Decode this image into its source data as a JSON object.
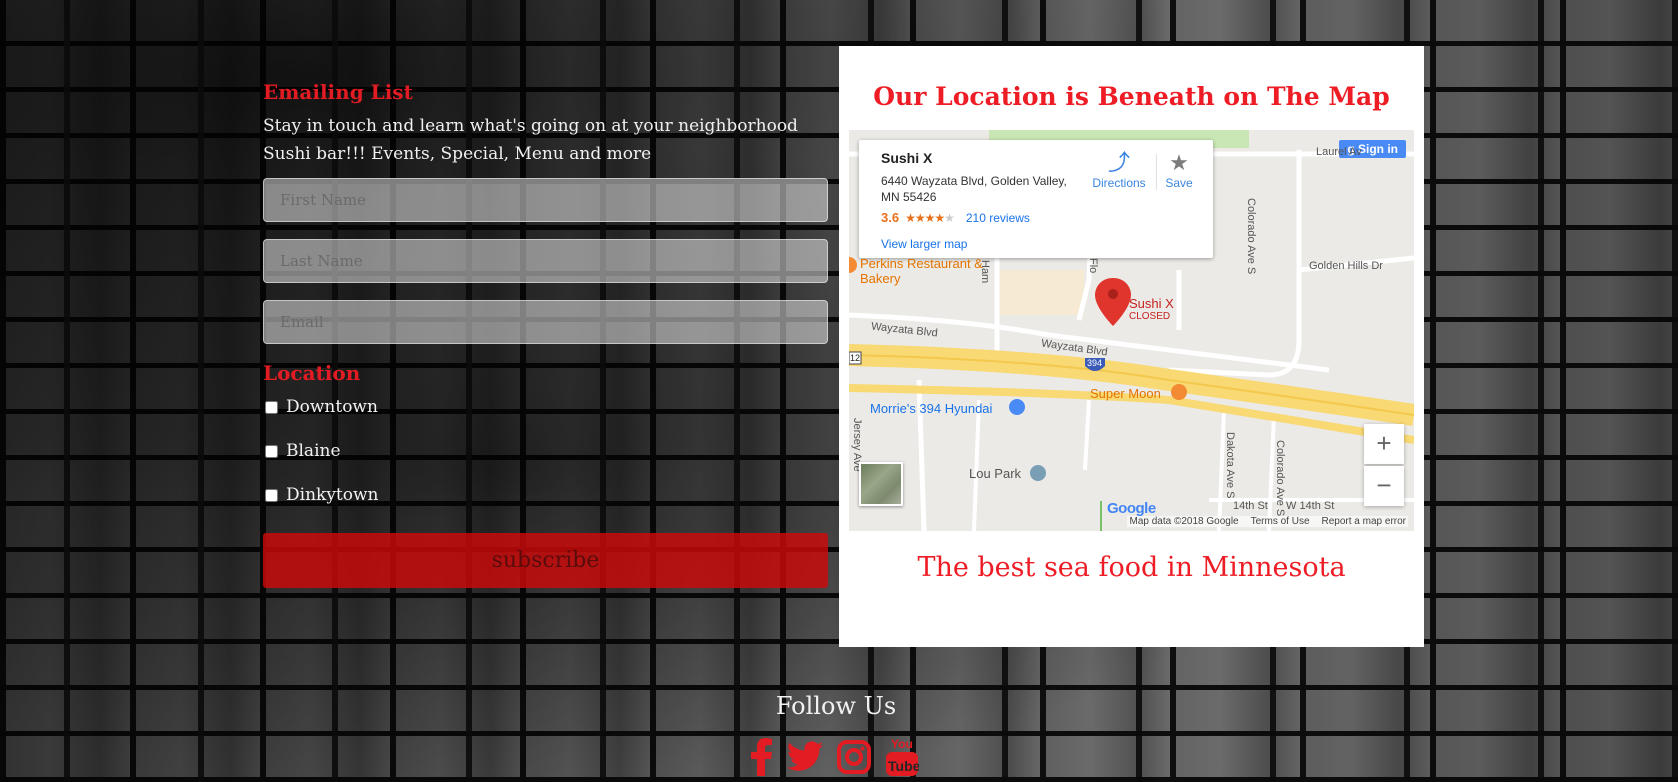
{
  "newsletter": {
    "title": "Emailing List",
    "intro": "Stay in touch and learn what's going on at your neighborhood Sushi bar!!! Events, Special, Menu and more",
    "first_name_placeholder": "First Name",
    "last_name_placeholder": "Last Name",
    "email_placeholder": "Email",
    "location_title": "Location",
    "locations": [
      "Downtown",
      "Blaine",
      "Dinkytown"
    ],
    "subscribe_label": "subscribe"
  },
  "map_section": {
    "heading": "Our Location is Beneath on The Map",
    "tagline": "The best sea food in Minnesota"
  },
  "map": {
    "place_name": "Sushi X",
    "address": "6440 Wayzata Blvd, Golden Valley, MN 55426",
    "rating": "3.6",
    "reviews": "210 reviews",
    "view_larger": "View larger map",
    "directions": "Directions",
    "save": "Save",
    "sign_in": "Sign in",
    "marker_name": "Sushi X",
    "marker_status": "CLOSED",
    "poi_perkins": "Perkins Restaurant & Bakery",
    "poi_hyundai": "Morrie's 394 Hyundai",
    "poi_supermoon": "Super Moon",
    "poi_loupark": "Lou Park",
    "street_laurel": "Laurel Av",
    "street_colorado": "Colorado Ave S",
    "street_golden_hills": "Golden Hills Dr",
    "street_wayzata_left": "Wayzata Blvd",
    "street_wayzata_mid": "Wayzata Blvd",
    "street_jersey": "Jersey Ave",
    "street_dakota": "Dakota Ave S",
    "street_colorado2": "Colorado Ave S",
    "street_14th": "14th St",
    "street_w14th": "W 14th St",
    "street_hampshire": "Ham",
    "street_florida": "Flo",
    "shield_394": "394",
    "shield_12": "12",
    "google": "Google",
    "attribution_data": "Map data ©2018 Google",
    "attribution_terms": "Terms of Use",
    "attribution_report": "Report a map error",
    "zoom_in": "+",
    "zoom_out": "−"
  },
  "footer": {
    "follow_title": "Follow Us",
    "social_icons": [
      "facebook-icon",
      "twitter-icon",
      "instagram-icon",
      "youtube-icon"
    ],
    "accent_color": "#e31b23"
  }
}
